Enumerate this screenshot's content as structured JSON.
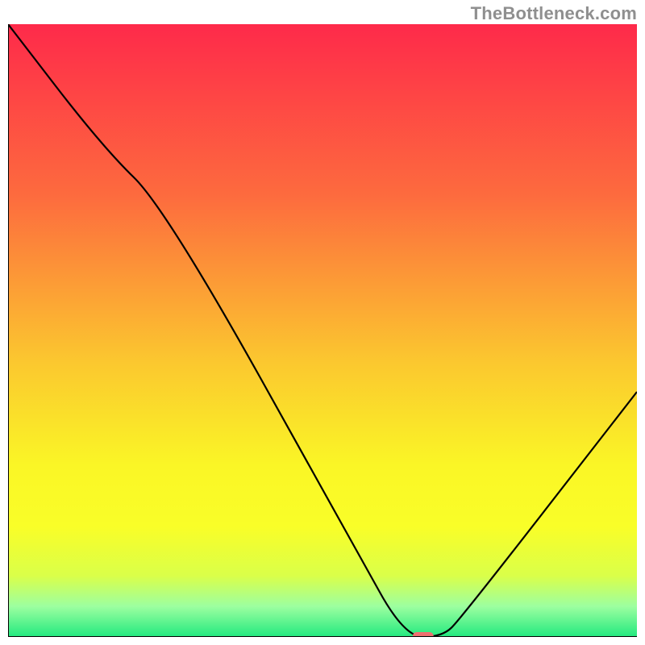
{
  "watermark": "TheBottleneck.com",
  "chart_data": {
    "type": "line",
    "title": "",
    "xlabel": "",
    "ylabel": "",
    "xlim": [
      0,
      100
    ],
    "ylim": [
      0,
      100
    ],
    "grid": false,
    "legend": false,
    "series": [
      {
        "name": "bottleneck-curve",
        "color": "#000000",
        "x": [
          0,
          15,
          25,
          55,
          63,
          69,
          72,
          100
        ],
        "values": [
          100,
          80,
          70,
          15,
          0,
          0,
          3,
          40
        ]
      }
    ],
    "marker": {
      "x": 66,
      "y": 0,
      "color": "#ef7070"
    },
    "background_gradient": {
      "stops": [
        {
          "offset": 0.0,
          "color": "#fe2a4a"
        },
        {
          "offset": 0.28,
          "color": "#fd6b3e"
        },
        {
          "offset": 0.55,
          "color": "#fbc72f"
        },
        {
          "offset": 0.72,
          "color": "#faf626"
        },
        {
          "offset": 0.82,
          "color": "#f9fe28"
        },
        {
          "offset": 0.9,
          "color": "#daff49"
        },
        {
          "offset": 0.95,
          "color": "#9dffa0"
        },
        {
          "offset": 1.0,
          "color": "#22e97f"
        }
      ]
    }
  }
}
